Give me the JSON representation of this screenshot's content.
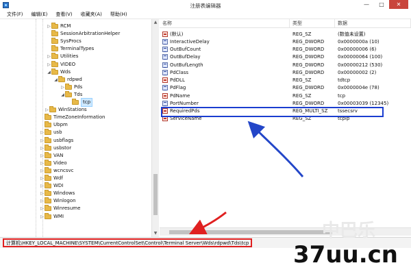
{
  "window": {
    "title": "注册表编辑器",
    "buttons": {
      "minimize": "—",
      "maximize": "□",
      "close": "✕"
    }
  },
  "menu": [
    "文件(F)",
    "编辑(E)",
    "查看(V)",
    "收藏夹(A)",
    "帮助(H)"
  ],
  "tree": [
    {
      "label": "RCM",
      "indent": 0,
      "arrow": "▷"
    },
    {
      "label": "SessionArbitrationHelper",
      "indent": 0,
      "arrow": ""
    },
    {
      "label": "SysProcs",
      "indent": 0,
      "arrow": ""
    },
    {
      "label": "TerminalTypes",
      "indent": 0,
      "arrow": ""
    },
    {
      "label": "Utilities",
      "indent": 0,
      "arrow": "▷"
    },
    {
      "label": "VIDEO",
      "indent": 0,
      "arrow": "▷"
    },
    {
      "label": "Wds",
      "indent": 0,
      "arrow": "◢"
    },
    {
      "label": "rdpwd",
      "indent": 1,
      "arrow": "◢"
    },
    {
      "label": "Pds",
      "indent": 2,
      "arrow": "▷"
    },
    {
      "label": "Tds",
      "indent": 2,
      "arrow": "◢"
    },
    {
      "label": "tcp",
      "indent": 3,
      "arrow": "",
      "selected": true
    },
    {
      "label": "WinStations",
      "indent": -0.3,
      "arrow": "▷"
    },
    {
      "label": "TimeZoneInformation",
      "indent": -1,
      "arrow": ""
    },
    {
      "label": "Ubpm",
      "indent": -1,
      "arrow": ""
    },
    {
      "label": "usb",
      "indent": -1,
      "arrow": "▷"
    },
    {
      "label": "usbflags",
      "indent": -1,
      "arrow": "▷"
    },
    {
      "label": "usbstor",
      "indent": -1,
      "arrow": "▷"
    },
    {
      "label": "VAN",
      "indent": -1,
      "arrow": "▷"
    },
    {
      "label": "Video",
      "indent": -1,
      "arrow": "▷"
    },
    {
      "label": "wcncsvc",
      "indent": -1,
      "arrow": "▷"
    },
    {
      "label": "Wdf",
      "indent": -1,
      "arrow": "▷"
    },
    {
      "label": "WDI",
      "indent": -1,
      "arrow": "▷"
    },
    {
      "label": "Windows",
      "indent": -1,
      "arrow": "▷"
    },
    {
      "label": "Winlogon",
      "indent": -1,
      "arrow": "▷"
    },
    {
      "label": "Winresume",
      "indent": -1,
      "arrow": "▷"
    },
    {
      "label": "WMI",
      "indent": -1,
      "arrow": "▷"
    }
  ],
  "list": {
    "columns": {
      "name": "名称",
      "type": "类型",
      "data": "数据"
    },
    "rows": [
      {
        "name": "(默认)",
        "type": "REG_SZ",
        "data": "(数值未设置)",
        "icon": "sz"
      },
      {
        "name": "InteractiveDelay",
        "type": "REG_DWORD",
        "data": "0x0000000a (10)",
        "icon": "bin"
      },
      {
        "name": "OutBufCount",
        "type": "REG_DWORD",
        "data": "0x00000006 (6)",
        "icon": "bin"
      },
      {
        "name": "OutBufDelay",
        "type": "REG_DWORD",
        "data": "0x00000064 (100)",
        "icon": "bin"
      },
      {
        "name": "OutBufLength",
        "type": "REG_DWORD",
        "data": "0x00000212 (530)",
        "icon": "bin"
      },
      {
        "name": "PdClass",
        "type": "REG_DWORD",
        "data": "0x00000002 (2)",
        "icon": "bin"
      },
      {
        "name": "PdDLL",
        "type": "REG_SZ",
        "data": "tdtcp",
        "icon": "sz"
      },
      {
        "name": "PdFlag",
        "type": "REG_DWORD",
        "data": "0x0000004e (78)",
        "icon": "bin"
      },
      {
        "name": "PdName",
        "type": "REG_SZ",
        "data": "tcp",
        "icon": "sz"
      },
      {
        "name": "PortNumber",
        "type": "REG_DWORD",
        "data": "0x00003039 (12345)",
        "icon": "bin"
      },
      {
        "name": "RequiredPds",
        "type": "REG_MULTI_SZ",
        "data": "tssecsrv",
        "icon": "sz"
      },
      {
        "name": "ServiceName",
        "type": "REG_SZ",
        "data": "tcpip",
        "icon": "sz"
      }
    ]
  },
  "status": {
    "path": "计算机\\HKEY_LOCAL_MACHINE\\SYSTEM\\CurrentControlSet\\Control\\Terminal Server\\Wds\\rdpwd\\Tds\\tcp"
  },
  "watermark": {
    "text": "37uu.cn",
    "faint": "中巴乐"
  },
  "annotation_colors": {
    "highlight": "#1a3dd0",
    "status_box": "#e02020",
    "blue_arrow": "#2346c8",
    "red_arrow": "#e02020"
  }
}
